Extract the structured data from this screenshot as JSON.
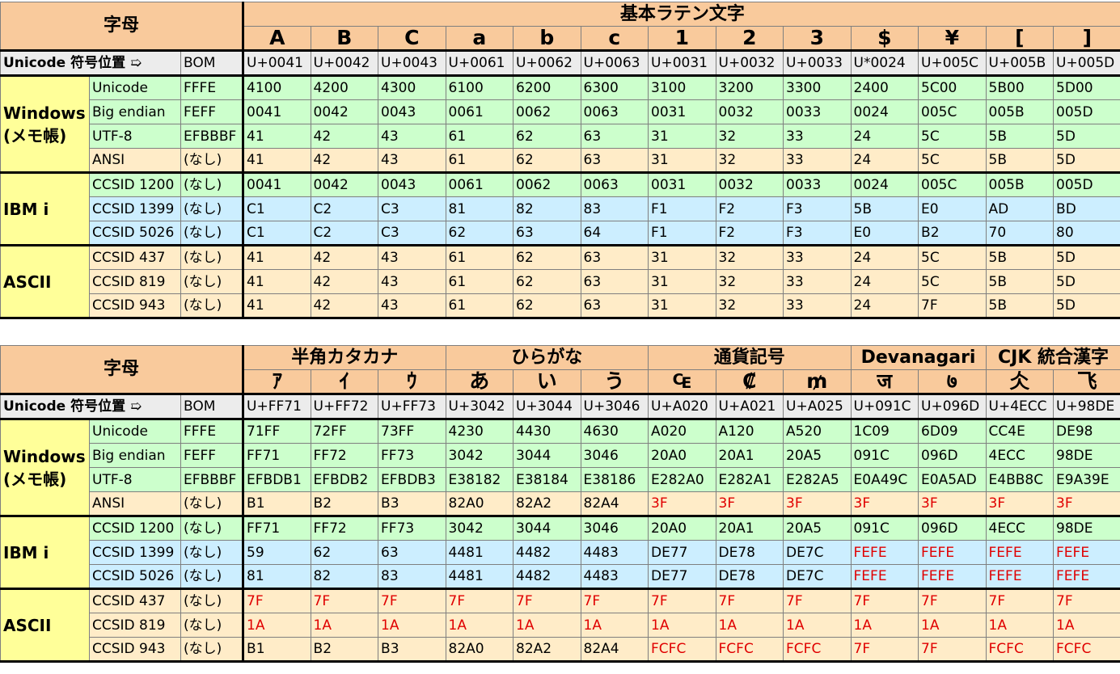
{
  "labels": {
    "alphabet": "字母",
    "codepoint": "Unicode 符号位置 ➯",
    "bom": "BOM"
  },
  "encodings": [
    {
      "name": "Unicode",
      "bom": "FFFE",
      "color": "g"
    },
    {
      "name": "Big endian",
      "bom": "FEFF",
      "color": "g"
    },
    {
      "name": "UTF-8",
      "bom": "EFBBBF",
      "color": "g"
    },
    {
      "name": "ANSI",
      "bom": "(なし)",
      "color": "y"
    },
    {
      "name": "CCSID 1200",
      "bom": "(なし)",
      "color": "g"
    },
    {
      "name": "CCSID 1399",
      "bom": "(なし)",
      "color": "b"
    },
    {
      "name": "CCSID 5026",
      "bom": "(なし)",
      "color": "b"
    },
    {
      "name": "CCSID 437",
      "bom": "(なし)",
      "color": "y"
    },
    {
      "name": "CCSID 819",
      "bom": "(なし)",
      "color": "y"
    },
    {
      "name": "CCSID 943",
      "bom": "(なし)",
      "color": "y"
    }
  ],
  "groups": [
    {
      "name": "Windows\n(メモ帳)",
      "start": 0,
      "rows": 4
    },
    {
      "name": "IBM i",
      "start": 4,
      "rows": 3
    },
    {
      "name": "ASCII",
      "start": 7,
      "rows": 3
    }
  ],
  "tables": [
    {
      "headers": [
        {
          "label": "基本ラテン文字",
          "span": 13
        }
      ],
      "chars": [
        "A",
        "B",
        "C",
        "a",
        "b",
        "c",
        "1",
        "2",
        "3",
        "$",
        "¥",
        "[",
        "]"
      ],
      "codepoints": [
        "U+0041",
        "U+0042",
        "U+0043",
        "U+0061",
        "U+0062",
        "U+0063",
        "U+0031",
        "U+0032",
        "U+0033",
        "U*0024",
        "U+005C",
        "U+005B",
        "U+005D"
      ],
      "rows": [
        [
          "4100",
          "4200",
          "4300",
          "6100",
          "6200",
          "6300",
          "3100",
          "3200",
          "3300",
          "2400",
          "5C00",
          "5B00",
          "5D00"
        ],
        [
          "0041",
          "0042",
          "0043",
          "0061",
          "0062",
          "0063",
          "0031",
          "0032",
          "0033",
          "0024",
          "005C",
          "005B",
          "005D"
        ],
        [
          "41",
          "42",
          "43",
          "61",
          "62",
          "63",
          "31",
          "32",
          "33",
          "24",
          "5C",
          "5B",
          "5D"
        ],
        [
          "41",
          "42",
          "43",
          "61",
          "62",
          "63",
          "31",
          "32",
          "33",
          "24",
          "5C",
          "5B",
          "5D"
        ],
        [
          "0041",
          "0042",
          "0043",
          "0061",
          "0062",
          "0063",
          "0031",
          "0032",
          "0033",
          "0024",
          "005C",
          "005B",
          "005D"
        ],
        [
          "C1",
          "C2",
          "C3",
          "81",
          "82",
          "83",
          "F1",
          "F2",
          "F3",
          "5B",
          "E0",
          "AD",
          "BD"
        ],
        [
          "C1",
          "C2",
          "C3",
          "62",
          "63",
          "64",
          "F1",
          "F2",
          "F3",
          "E0",
          "B2",
          "70",
          "80"
        ],
        [
          "41",
          "42",
          "43",
          "61",
          "62",
          "63",
          "31",
          "32",
          "33",
          "24",
          "5C",
          "5B",
          "5D"
        ],
        [
          "41",
          "42",
          "43",
          "61",
          "62",
          "63",
          "31",
          "32",
          "33",
          "24",
          "5C",
          "5B",
          "5D"
        ],
        [
          "41",
          "42",
          "43",
          "61",
          "62",
          "63",
          "31",
          "32",
          "33",
          "24",
          "7F",
          "5B",
          "5D"
        ]
      ]
    },
    {
      "headers": [
        {
          "label": "半角カタカナ",
          "span": 3
        },
        {
          "label": "ひらがな",
          "span": 3
        },
        {
          "label": "通貨記号",
          "span": 3
        },
        {
          "label": "Devanagari",
          "span": 2
        },
        {
          "label": "CJK 統合漢字",
          "span": 2
        }
      ],
      "chars": [
        "ｱ",
        "ｲ",
        "ｳ",
        "あ",
        "い",
        "う",
        "₠",
        "₡",
        "₥",
        "ज",
        "७",
        "仌",
        "飞"
      ],
      "codepoints": [
        "U+FF71",
        "U+FF72",
        "U+FF73",
        "U+3042",
        "U+3044",
        "U+3046",
        "U+A020",
        "U+A021",
        "U+A025",
        "U+091C",
        "U+096D",
        "U+4ECC",
        "U+98DE"
      ],
      "rows": [
        [
          "71FF",
          "72FF",
          "73FF",
          "4230",
          "4430",
          "4630",
          "A020",
          "A120",
          "A520",
          "1C09",
          "6D09",
          "CC4E",
          "DE98"
        ],
        [
          "FF71",
          "FF72",
          "FF73",
          "3042",
          "3044",
          "3046",
          "20A0",
          "20A1",
          "20A5",
          "091C",
          "096D",
          "4ECC",
          "98DE"
        ],
        [
          "EFBDB1",
          "EFBDB2",
          "EFBDB3",
          "E38182",
          "E38184",
          "E38186",
          "E282A0",
          "E282A1",
          "E282A5",
          "E0A49C",
          "E0A5AD",
          "E4BB8C",
          "E9A39E"
        ],
        [
          "B1",
          "B2",
          "B3",
          "82A0",
          "82A2",
          "82A4",
          "3F",
          "3F",
          "3F",
          "3F",
          "3F",
          "3F",
          "3F"
        ],
        [
          "FF71",
          "FF72",
          "FF73",
          "3042",
          "3044",
          "3046",
          "20A0",
          "20A1",
          "20A5",
          "091C",
          "096D",
          "4ECC",
          "98DE"
        ],
        [
          "59",
          "62",
          "63",
          "4481",
          "4482",
          "4483",
          "DE77",
          "DE78",
          "DE7C",
          "FEFE",
          "FEFE",
          "FEFE",
          "FEFE"
        ],
        [
          "81",
          "82",
          "83",
          "4481",
          "4482",
          "4483",
          "DE77",
          "DE78",
          "DE7C",
          "FEFE",
          "FEFE",
          "FEFE",
          "FEFE"
        ],
        [
          "7F",
          "7F",
          "7F",
          "7F",
          "7F",
          "7F",
          "7F",
          "7F",
          "7F",
          "7F",
          "7F",
          "7F",
          "7F"
        ],
        [
          "1A",
          "1A",
          "1A",
          "1A",
          "1A",
          "1A",
          "1A",
          "1A",
          "1A",
          "1A",
          "1A",
          "1A",
          "1A"
        ],
        [
          "B1",
          "B2",
          "B3",
          "82A0",
          "82A2",
          "82A4",
          "FCFC",
          "FCFC",
          "FCFC",
          "7F",
          "7F",
          "FCFC",
          "FCFC"
        ]
      ],
      "red": [
        [
          3,
          6
        ],
        [
          3,
          7
        ],
        [
          3,
          8
        ],
        [
          3,
          9
        ],
        [
          3,
          10
        ],
        [
          3,
          11
        ],
        [
          3,
          12
        ],
        [
          5,
          9
        ],
        [
          5,
          10
        ],
        [
          5,
          11
        ],
        [
          5,
          12
        ],
        [
          6,
          9
        ],
        [
          6,
          10
        ],
        [
          6,
          11
        ],
        [
          6,
          12
        ],
        [
          7,
          0
        ],
        [
          7,
          1
        ],
        [
          7,
          2
        ],
        [
          7,
          3
        ],
        [
          7,
          4
        ],
        [
          7,
          5
        ],
        [
          7,
          6
        ],
        [
          7,
          7
        ],
        [
          7,
          8
        ],
        [
          7,
          9
        ],
        [
          7,
          10
        ],
        [
          7,
          11
        ],
        [
          7,
          12
        ],
        [
          8,
          0
        ],
        [
          8,
          1
        ],
        [
          8,
          2
        ],
        [
          8,
          3
        ],
        [
          8,
          4
        ],
        [
          8,
          5
        ],
        [
          8,
          6
        ],
        [
          8,
          7
        ],
        [
          8,
          8
        ],
        [
          8,
          9
        ],
        [
          8,
          10
        ],
        [
          8,
          11
        ],
        [
          8,
          12
        ],
        [
          9,
          6
        ],
        [
          9,
          7
        ],
        [
          9,
          8
        ],
        [
          9,
          9
        ],
        [
          9,
          10
        ],
        [
          9,
          11
        ],
        [
          9,
          12
        ]
      ]
    }
  ]
}
